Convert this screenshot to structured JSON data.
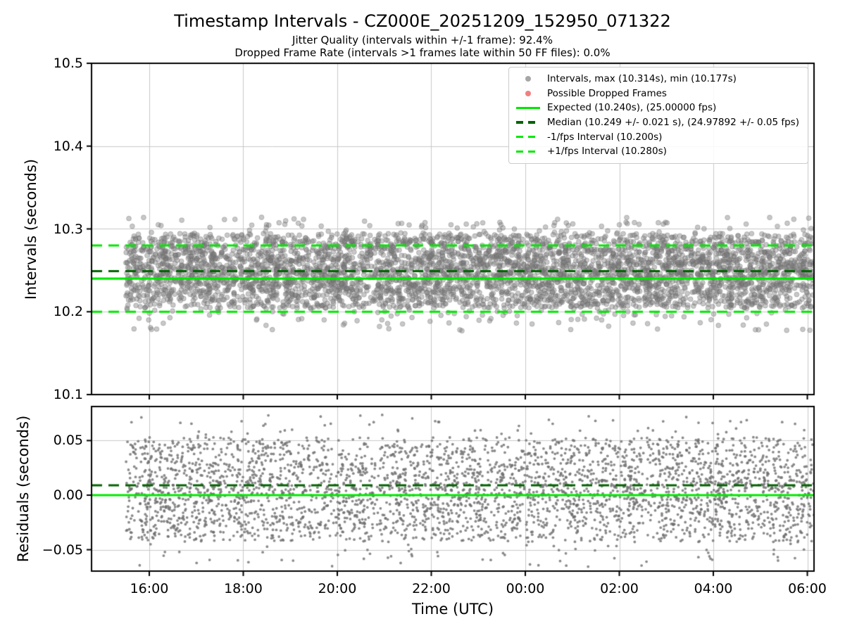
{
  "header": {
    "title": "Timestamp Intervals - CZ000E_20251209_152950_071322",
    "subtitle_jitter": "Jitter Quality (intervals within +/-1 frame): 92.4%",
    "subtitle_dropped": "Dropped Frame Rate (intervals >1 frames late within 50 FF files): 0.0%"
  },
  "colors": {
    "lime": "#00e800",
    "dark_green": "#006400",
    "scatter_gray": "#808080",
    "dropped_red": "#f08080",
    "grid": "#c9c9c9",
    "spine": "#000000"
  },
  "legend": {
    "items": [
      {
        "marker": "dot",
        "dash": false,
        "color": "#a6a6a6",
        "label": "Intervals, max (10.314s), min (10.177s)"
      },
      {
        "marker": "dot",
        "dash": false,
        "color": "#f08080",
        "label": "Possible Dropped Frames"
      },
      {
        "marker": "line",
        "dash": false,
        "color": "#00e800",
        "label": "Expected (10.240s), (25.00000 fps)"
      },
      {
        "marker": "line",
        "dash": true,
        "color": "#006400",
        "label": "Median (10.249 +/- 0.021 s), (24.97892 +/- 0.05 fps)"
      },
      {
        "marker": "line",
        "dash": true,
        "color": "#00e800",
        "label": "-1/fps Interval (10.200s)"
      },
      {
        "marker": "line",
        "dash": true,
        "color": "#00e800",
        "label": "+1/fps Interval (10.280s)"
      }
    ]
  },
  "chart_data": {
    "x_axis": {
      "label": "Time (UTC)",
      "xlim_hours": [
        14.772,
        30.142
      ],
      "tick_hours": [
        16,
        18,
        20,
        22,
        24,
        26,
        28,
        30
      ],
      "tick_labels": [
        "16:00",
        "18:00",
        "20:00",
        "22:00",
        "00:00",
        "02:00",
        "04:00",
        "06:00"
      ],
      "data_start_hour": 15.497,
      "data_end_hour": 30.142,
      "grid": true
    },
    "panels": [
      {
        "name": "intervals",
        "type": "scatter",
        "ylabel": "Intervals (seconds)",
        "ylim": [
          10.1,
          10.5
        ],
        "ytick_values": [
          10.5,
          10.4,
          10.3,
          10.2,
          10.1
        ],
        "ytick_labels": [
          "10.5",
          "10.4",
          "10.3",
          "10.2",
          "10.1"
        ],
        "series": [
          {
            "name": "Intervals",
            "n_points": 4600,
            "fill": "rgba(125,125,125,0.42)",
            "stroke": "rgba(100,100,100,0.35)",
            "radius": 3.4,
            "stats": {
              "max": 10.314,
              "min": 10.177,
              "median": 10.249,
              "median_err": 0.021,
              "expected": 10.24,
              "fps": 25.0,
              "median_fps": 24.97892,
              "pct_within_1_frame": 92.4
            },
            "gen": {
              "seed": 1001,
              "core": {
                "frac": 0.55,
                "min": 10.2045,
                "max": 10.2945
              },
              "tri": {
                "frac": 0.35,
                "center": 10.2495,
                "hw": 0.05
              },
              "wide": {
                "frac": 0.08,
                "min": 10.19,
                "max": 10.308
              },
              "tails": {
                "low_min": 10.177,
                "low_max": 10.198,
                "high_min": 10.3,
                "high_max": 10.314
              }
            }
          }
        ],
        "ref_lines": [
          {
            "name": "minus-1fps",
            "value": 10.2,
            "color": "#00e800",
            "dash": true,
            "lw": 3
          },
          {
            "name": "plus-1fps",
            "value": 10.28,
            "color": "#00e800",
            "dash": true,
            "lw": 3
          },
          {
            "name": "median",
            "value": 10.249,
            "color": "#006400",
            "dash": true,
            "lw": 3
          },
          {
            "name": "expected",
            "value": 10.24,
            "color": "#00e800",
            "dash": false,
            "lw": 3.2
          }
        ],
        "show_x_tick_labels": false
      },
      {
        "name": "residuals",
        "type": "scatter",
        "ylabel": "Residuals (seconds)",
        "ylim": [
          -0.0696,
          0.0812
        ],
        "ytick_values": [
          0.05,
          0.0,
          -0.05
        ],
        "ytick_labels": [
          "0.05",
          "0.00",
          "−0.05"
        ],
        "series": [
          {
            "name": "Residuals",
            "n_points": 3600,
            "fill": "rgba(110,110,110,0.8)",
            "stroke": "",
            "radius": 1.9,
            "stats": {
              "max": 0.0735,
              "min": -0.0655,
              "median": 0.009,
              "zero": 0.0
            },
            "gen": {
              "seed": 2002,
              "core": {
                "frac": 0.55,
                "min": -0.043,
                "max": 0.053
              },
              "tri": {
                "frac": 0.35,
                "center": 0.005,
                "hw": 0.048
              },
              "wide": {
                "frac": 0.08,
                "min": -0.06,
                "max": 0.068
              },
              "tails": {
                "low_min": -0.0655,
                "low_max": -0.05,
                "high_min": 0.058,
                "high_max": 0.0735
              }
            }
          }
        ],
        "ref_lines": [
          {
            "name": "median-residual",
            "value": 0.009,
            "color": "#006400",
            "dash": true,
            "lw": 3
          },
          {
            "name": "zero",
            "value": 0.0,
            "color": "#00e800",
            "dash": false,
            "lw": 3.2
          }
        ],
        "show_x_tick_labels": true
      }
    ]
  }
}
